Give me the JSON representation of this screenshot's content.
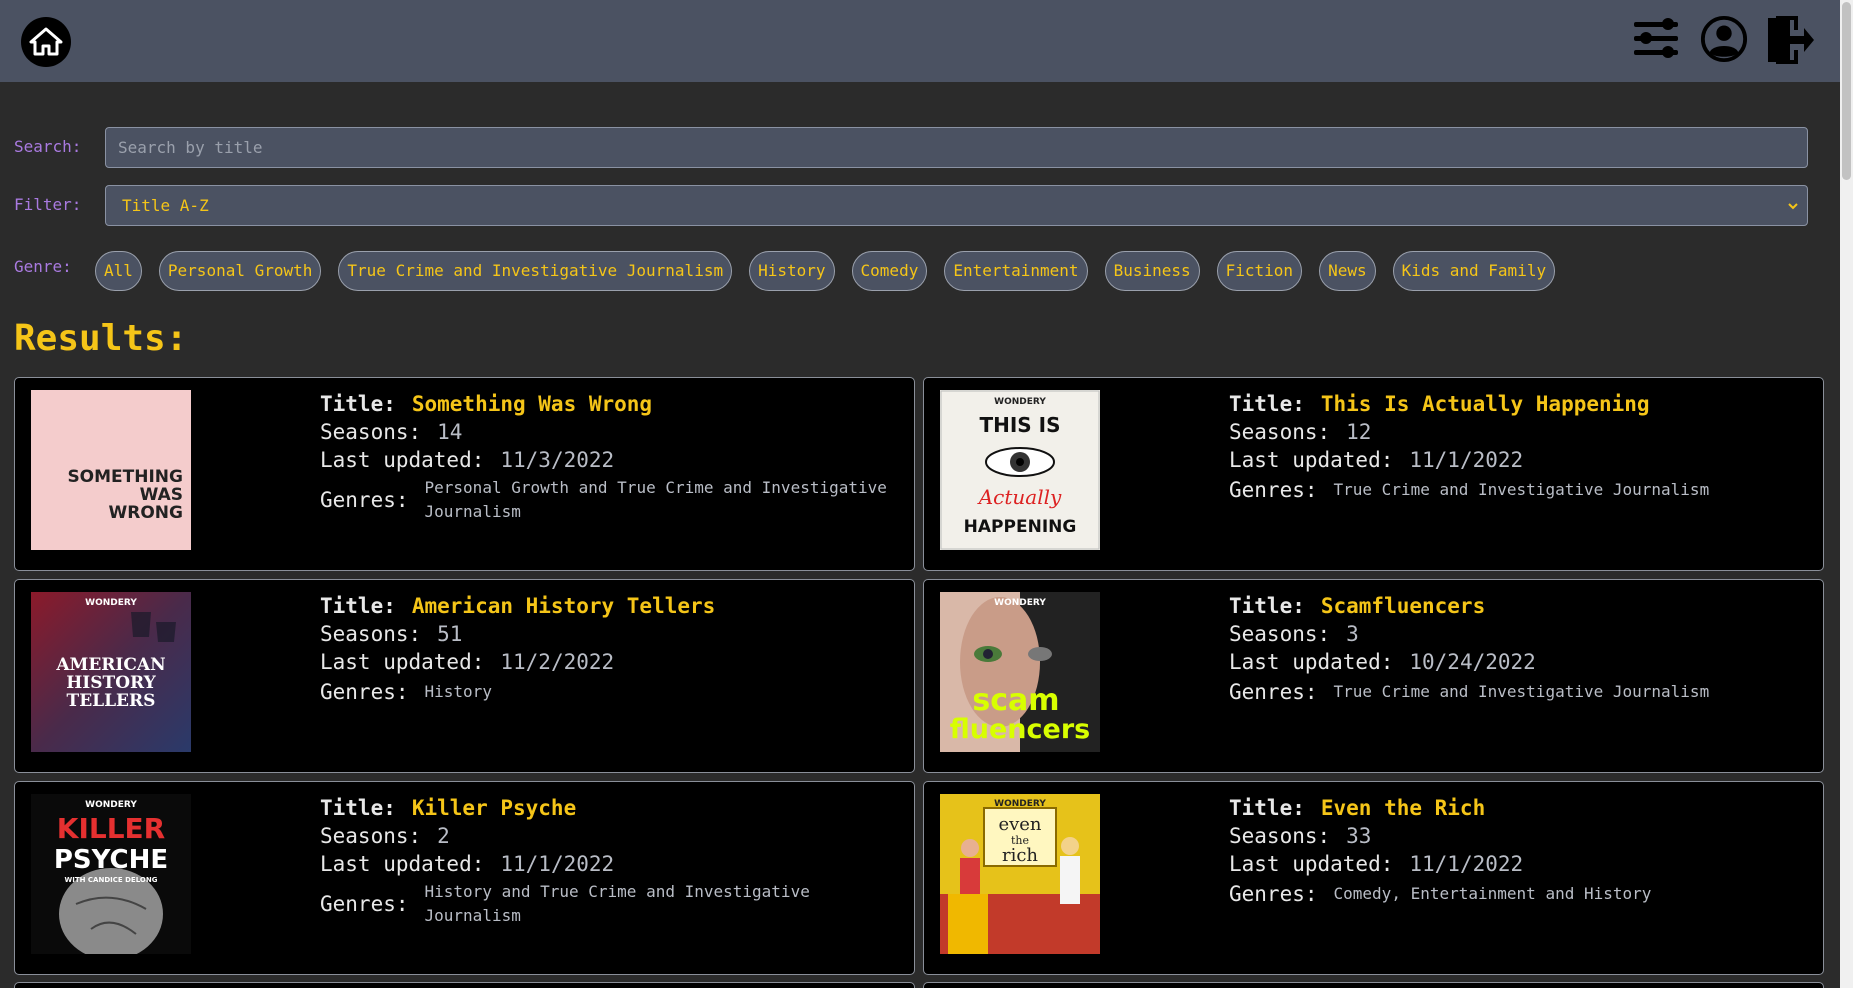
{
  "search": {
    "label": "Search:",
    "placeholder": "Search by title",
    "value": ""
  },
  "filter": {
    "label": "Filter:",
    "value": "Title A-Z"
  },
  "genre": {
    "label": "Genre:",
    "chips": [
      "All",
      "Personal Growth",
      "True Crime and Investigative Journalism",
      "History",
      "Comedy",
      "Entertainment",
      "Business",
      "Fiction",
      "News",
      "Kids and Family"
    ]
  },
  "results": {
    "heading": "Results:",
    "labels": {
      "title": "Title:",
      "seasons": "Seasons:",
      "updated": "Last updated:",
      "genres": "Genres:"
    },
    "items": [
      {
        "title": "Something Was Wrong",
        "seasons": "14",
        "updated": "11/3/2022",
        "genres": "Personal Growth and True Crime and Investigative Journalism",
        "cover_text": [
          "SOMETHING",
          "WAS",
          "WRONG"
        ]
      },
      {
        "title": "This Is Actually Happening",
        "seasons": "12",
        "updated": "11/1/2022",
        "genres": "True Crime and Investigative Journalism",
        "cover_text": [
          "WONDERY",
          "THIS IS",
          "Actually",
          "HAPPENING"
        ]
      },
      {
        "title": "American History Tellers",
        "seasons": "51",
        "updated": "11/2/2022",
        "genres": "History",
        "cover_text": [
          "WONDERY",
          "AMERICAN",
          "HISTORY",
          "TELLERS"
        ]
      },
      {
        "title": "Scamfluencers",
        "seasons": "3",
        "updated": "10/24/2022",
        "genres": "True Crime and Investigative Journalism",
        "cover_text": [
          "WONDERY",
          "scam",
          "fluencers"
        ]
      },
      {
        "title": "Killer Psyche",
        "seasons": "2",
        "updated": "11/1/2022",
        "genres": "History and True Crime and Investigative Journalism",
        "cover_text": [
          "WONDERY",
          "KILLER",
          "PSYCHE",
          "WITH CANDICE DELONG"
        ]
      },
      {
        "title": "Even the Rich",
        "seasons": "33",
        "updated": "11/1/2022",
        "genres": "Comedy, Entertainment and History",
        "cover_text": [
          "WONDERY",
          "even",
          "the",
          "rich"
        ]
      }
    ]
  },
  "icons": {
    "home": "home-icon",
    "filter": "sliders-icon",
    "profile": "user-circle-icon",
    "logout": "logout-icon"
  },
  "colors": {
    "accent": "#f5c518",
    "label": "#a97ae0",
    "header": "#4b5262",
    "background": "#2b2b2b"
  }
}
